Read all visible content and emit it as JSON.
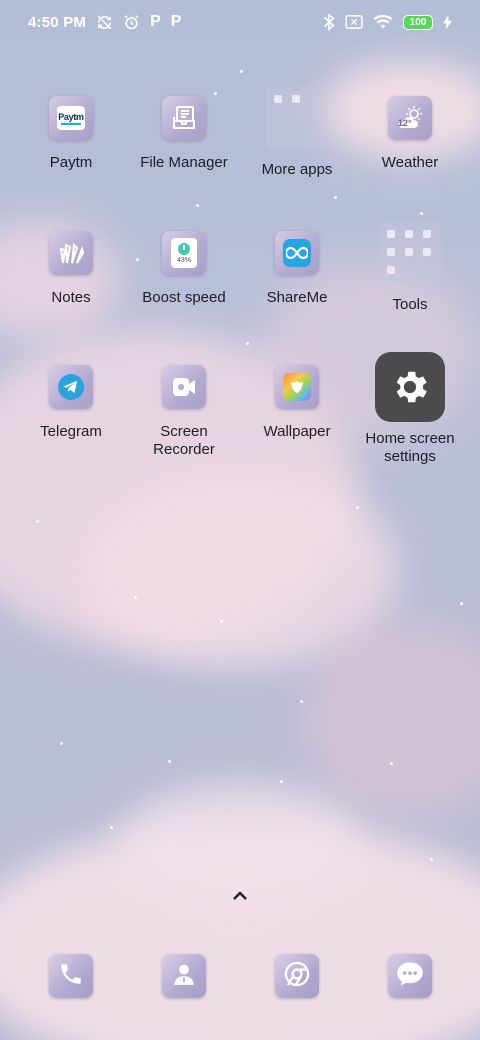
{
  "status_bar": {
    "time": "4:50 PM",
    "left_icons": [
      "sync-off-icon",
      "alarm-icon",
      "paytm-notification-icon",
      "paytm-notification-icon"
    ],
    "p_glyph": "P",
    "right_icons": [
      "bluetooth-icon",
      "no-sim-icon",
      "wifi-icon",
      "battery-icon",
      "charging-icon"
    ],
    "battery_level": "100"
  },
  "apps": [
    {
      "label": "Paytm",
      "icon": "paytm-icon"
    },
    {
      "label": "File Manager",
      "icon": "file-manager-icon"
    },
    {
      "label": "More apps",
      "icon": "folder-icon"
    },
    {
      "label": "Weather",
      "icon": "weather-icon",
      "icon_text": "12°"
    },
    {
      "label": "Notes",
      "icon": "notes-icon"
    },
    {
      "label": "Boost speed",
      "icon": "boost-speed-icon",
      "icon_text": "43%"
    },
    {
      "label": "ShareMe",
      "icon": "shareme-icon"
    },
    {
      "label": "Tools",
      "icon": "folder-icon"
    },
    {
      "label": "Telegram",
      "icon": "telegram-icon"
    },
    {
      "label": "Screen\nRecorder",
      "icon": "screen-recorder-icon"
    },
    {
      "label": "Wallpaper",
      "icon": "wallpaper-icon"
    },
    {
      "label": "Home screen\nsettings",
      "icon": "gear-icon"
    }
  ],
  "paytm_icon_text": "Paytm",
  "dock": [
    {
      "name": "phone",
      "icon": "phone-icon"
    },
    {
      "name": "contacts",
      "icon": "contacts-icon"
    },
    {
      "name": "chrome",
      "icon": "chrome-icon"
    },
    {
      "name": "messages",
      "icon": "messages-icon"
    }
  ],
  "colors": {
    "sky": "#b7bdd6",
    "cloud": "#f1dde6",
    "icon_tile": "#b3aad0",
    "settings_tile": "#4b4b4d",
    "battery": "#57d85a",
    "label_text": "#1e1e24"
  }
}
